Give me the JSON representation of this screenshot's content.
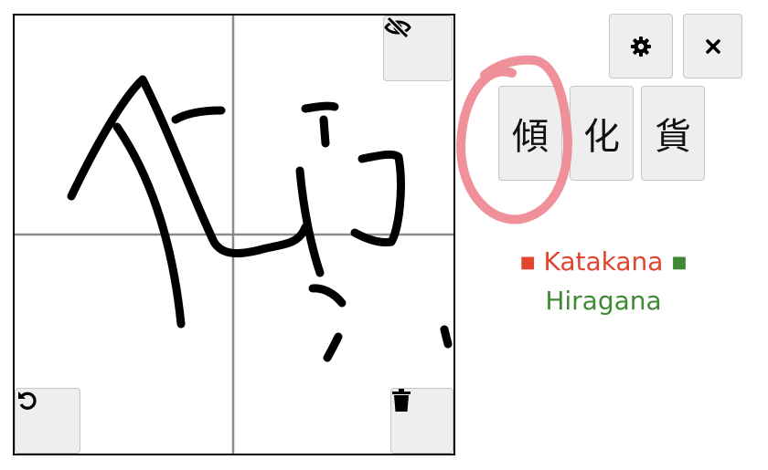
{
  "toolbar": {
    "hide_icon": "eye-slash-icon",
    "settings_icon": "gear-icon",
    "close_icon": "close-icon",
    "undo_icon": "undo-icon",
    "clear_icon": "trash-icon"
  },
  "candidates": [
    {
      "char": "傾"
    },
    {
      "char": "化"
    },
    {
      "char": "貨"
    }
  ],
  "legend": {
    "katakana_marker": "■",
    "katakana_label": "Katakana",
    "hiragana_marker": "■",
    "hiragana_label": "Hiragana"
  },
  "colors": {
    "katakana": "#e2442f",
    "hiragana": "#3e8a33",
    "highlight_circle": "#ee8a95"
  }
}
